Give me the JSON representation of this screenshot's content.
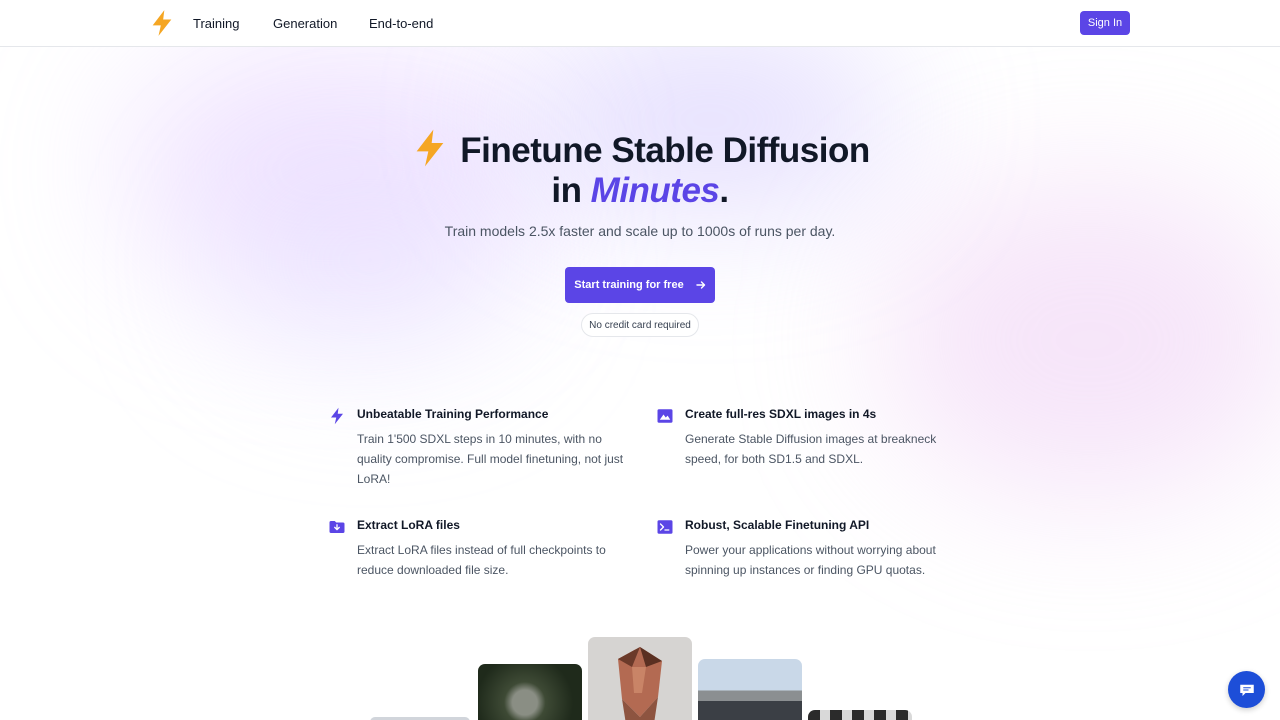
{
  "nav": {
    "logo_icon": "lightning-bolt-icon",
    "links": [
      "Training",
      "Generation",
      "End-to-end"
    ],
    "signin_label": "Sign In"
  },
  "hero": {
    "title_line1": "Finetune Stable Diffusion",
    "title_in": "in ",
    "title_accent": "Minutes",
    "title_period": ".",
    "subtitle": "Train models 2.5x faster and scale up to 1000s of runs per day.",
    "cta_label": "Start training for free",
    "note": "No credit card required"
  },
  "features": [
    {
      "icon": "lightning-bolt-icon",
      "title": "Unbeatable Training Performance",
      "description": "Train 1'500 SDXL steps in 10 minutes, with no quality compromise. Full model finetuning, not just LoRA!"
    },
    {
      "icon": "image-icon",
      "title": "Create full-res SDXL images in 4s",
      "description": "Generate Stable Diffusion images at breakneck speed, for both SD1.5 and SDXL."
    },
    {
      "icon": "folder-download-icon",
      "title": "Extract LoRA files",
      "description": "Extract LoRA files instead of full checkpoints to reduce downloaded file size."
    },
    {
      "icon": "terminal-icon",
      "title": "Robust, Scalable Finetuning API",
      "description": "Power your applications without worrying about spinning up instances or finding GPU quotas."
    }
  ],
  "colors": {
    "accent": "#5b45e6",
    "bolt": "#f5a623",
    "chat": "#1d4ed8"
  }
}
